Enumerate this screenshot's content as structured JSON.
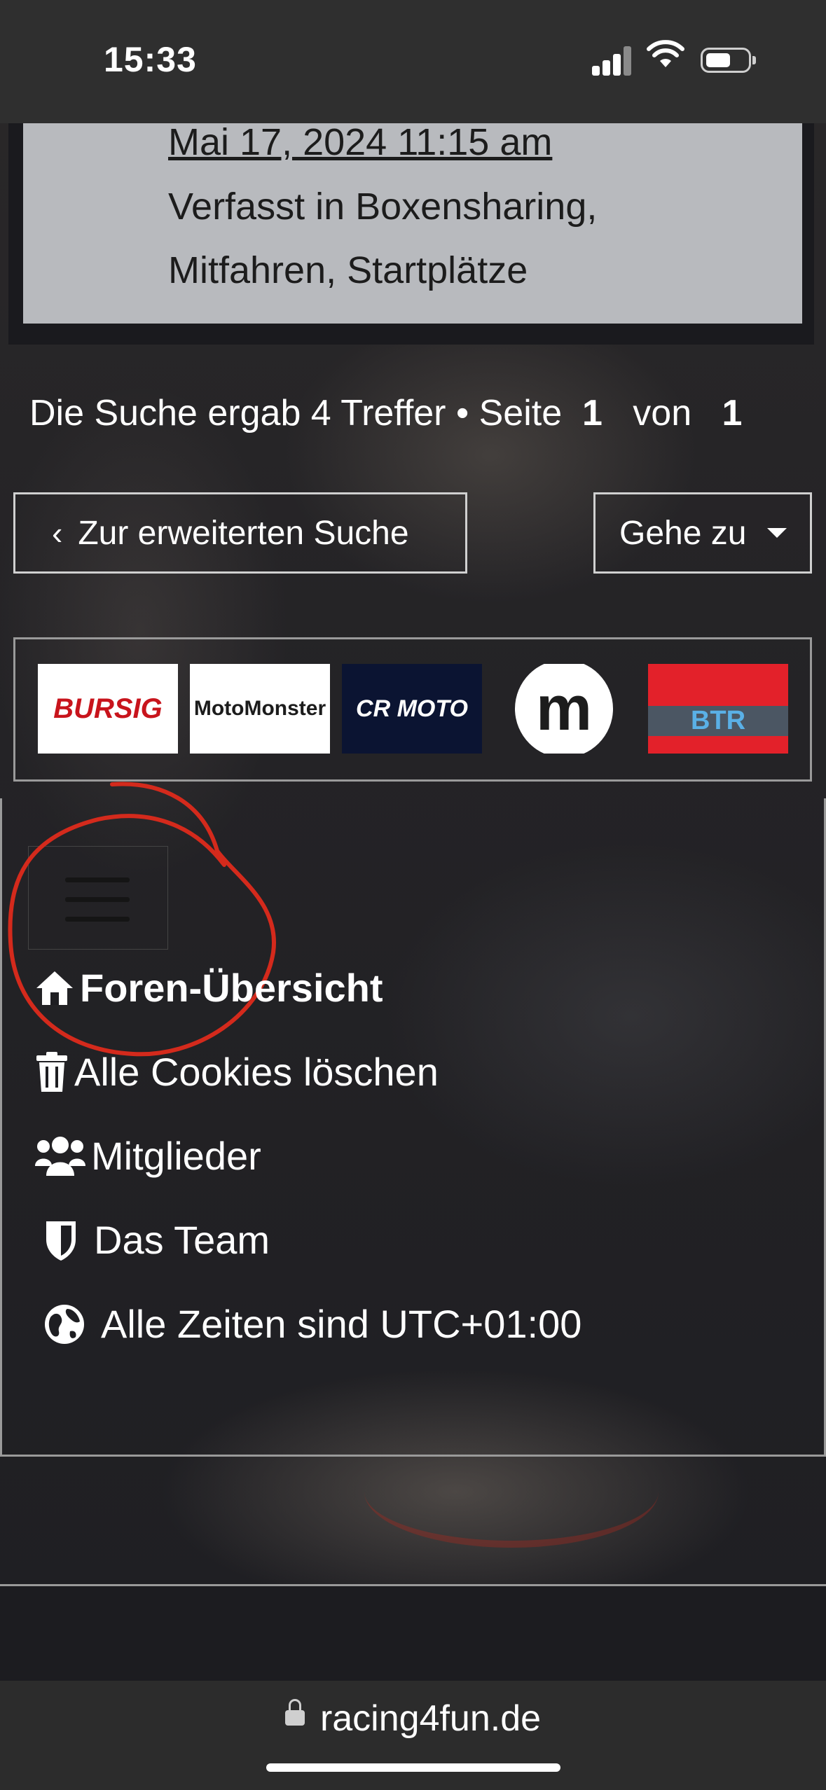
{
  "status_bar": {
    "time": "15:33"
  },
  "post": {
    "date": "Mai 17, 2024 11:15 am",
    "categories_line1": "Verfasst in Boxensharing,",
    "categories_line2": "Mitfahren, Startplätze"
  },
  "search_results": {
    "text": "Die Suche ergab 4 Treffer • Seite",
    "page": "1",
    "of": "von",
    "total_pages": "1"
  },
  "buttons": {
    "advanced_search": "Zur erweiterten Suche",
    "goto": "Gehe zu"
  },
  "sponsors": {
    "logo1": "BURSIG",
    "logo2": "MotoMonster",
    "logo3": "CR MOTO",
    "logo4": "m",
    "logo5": "BTR"
  },
  "nav": {
    "items": [
      {
        "label": "Foren-Übersicht",
        "icon": "home-icon"
      },
      {
        "label": "Alle Cookies löschen",
        "icon": "trash-icon"
      },
      {
        "label": "Mitglieder",
        "icon": "users-icon"
      },
      {
        "label": "Das Team",
        "icon": "shield-icon"
      },
      {
        "label": "Alle Zeiten sind UTC+01:00",
        "icon": "globe-icon"
      }
    ]
  },
  "browser": {
    "url": "racing4fun.de"
  },
  "colors": {
    "annotation": "#d42a1c",
    "card": "#b8babe",
    "statusbar": "#2f2f2f"
  }
}
